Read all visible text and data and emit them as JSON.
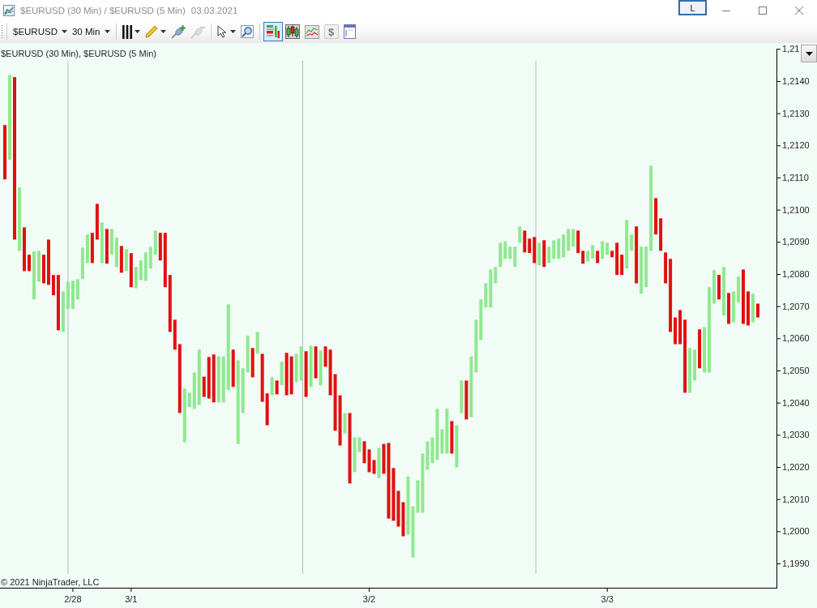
{
  "window": {
    "title": "$EURUSD (30 Min) / $EURUSD (5 Min)",
    "date": "03.03.2021",
    "link_button": "L"
  },
  "toolbar": {
    "instrument": "$EURUSD",
    "interval": "30 Min",
    "tool_groups": [
      [
        {
          "kind": "bar-style",
          "dropdown": true,
          "selected": false,
          "disabled": false
        },
        {
          "kind": "pencil",
          "dropdown": true,
          "selected": false,
          "disabled": false
        },
        {
          "kind": "pin-add",
          "dropdown": false,
          "selected": false,
          "disabled": false
        },
        {
          "kind": "pin-remove",
          "dropdown": false,
          "selected": false,
          "disabled": true
        }
      ],
      [
        {
          "kind": "pointer",
          "dropdown": true,
          "selected": false,
          "disabled": false
        },
        {
          "kind": "zoom",
          "dropdown": false,
          "selected": false,
          "disabled": false
        }
      ],
      [
        {
          "kind": "price-bars",
          "dropdown": false,
          "selected": true,
          "disabled": false
        },
        {
          "kind": "candles",
          "dropdown": false,
          "selected": false,
          "disabled": false
        },
        {
          "kind": "line-chart",
          "dropdown": false,
          "selected": false,
          "disabled": false
        },
        {
          "kind": "dollar",
          "label": "$",
          "dropdown": false,
          "selected": false,
          "disabled": true
        },
        {
          "kind": "layout",
          "dropdown": false,
          "selected": false,
          "disabled": false
        }
      ]
    ]
  },
  "chart": {
    "legend": "$EURUSD (30 Min), $EURUSD (5 Min)",
    "copyright": "© 2021 NinjaTrader, LLC",
    "price_axis": [
      "1,21",
      "1,2140",
      "1,2130",
      "1,2120",
      "1,2110",
      "1,2100",
      "1,2090",
      "1,2080",
      "1,2070",
      "1,2060",
      "1,2050",
      "1,2040",
      "1,2030",
      "1,2020",
      "1,2010",
      "1,2000",
      "1,1990"
    ],
    "date_axis": [
      "2/28",
      "3/1",
      "3/2",
      "3/3"
    ]
  }
}
